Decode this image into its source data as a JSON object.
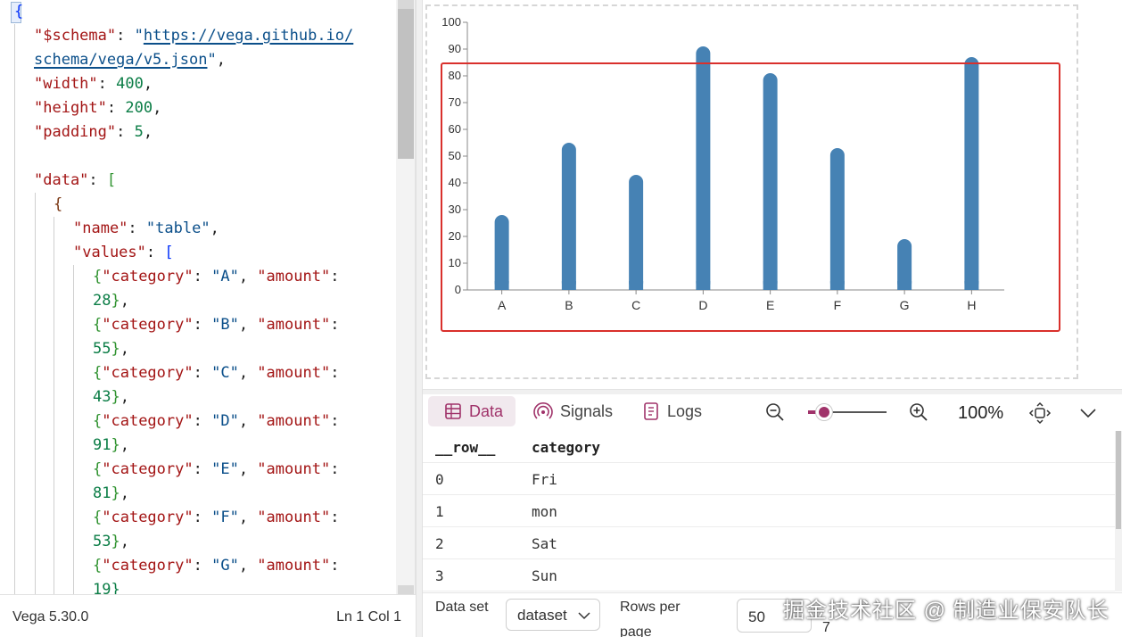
{
  "editor": {
    "code_lines": [
      [
        {
          "t": "{",
          "c": "b1"
        }
      ],
      [
        {
          "t": "\"$schema\"",
          "c": "k"
        },
        {
          "t": ": ",
          "c": "p"
        },
        {
          "t": "\"",
          "c": "s"
        },
        {
          "t": "https://vega.github.io/",
          "c": "s lnk"
        }
      ],
      [
        {
          "t": "schema/vega/v5.json",
          "c": "s lnk"
        },
        {
          "t": "\"",
          "c": "s"
        },
        {
          "t": ",",
          "c": "p"
        }
      ],
      [
        {
          "t": "\"width\"",
          "c": "k"
        },
        {
          "t": ": ",
          "c": "p"
        },
        {
          "t": "400",
          "c": "n"
        },
        {
          "t": ",",
          "c": "p"
        }
      ],
      [
        {
          "t": "\"height\"",
          "c": "k"
        },
        {
          "t": ": ",
          "c": "p"
        },
        {
          "t": "200",
          "c": "n"
        },
        {
          "t": ",",
          "c": "p"
        }
      ],
      [
        {
          "t": "\"padding\"",
          "c": "k"
        },
        {
          "t": ": ",
          "c": "p"
        },
        {
          "t": "5",
          "c": "n"
        },
        {
          "t": ",",
          "c": "p"
        }
      ],
      [],
      [
        {
          "t": "\"data\"",
          "c": "k"
        },
        {
          "t": ": ",
          "c": "p"
        },
        {
          "t": "[",
          "c": "b2"
        }
      ],
      [
        {
          "t": "{",
          "c": "b3"
        }
      ],
      [
        {
          "t": "\"name\"",
          "c": "k"
        },
        {
          "t": ": ",
          "c": "p"
        },
        {
          "t": "\"table\"",
          "c": "s"
        },
        {
          "t": ",",
          "c": "p"
        }
      ],
      [
        {
          "t": "\"values\"",
          "c": "k"
        },
        {
          "t": ": ",
          "c": "p"
        },
        {
          "t": "[",
          "c": "b1"
        }
      ],
      [
        {
          "t": "{",
          "c": "b2"
        },
        {
          "t": "\"category\"",
          "c": "k"
        },
        {
          "t": ": ",
          "c": "p"
        },
        {
          "t": "\"A\"",
          "c": "s"
        },
        {
          "t": ", ",
          "c": "p"
        },
        {
          "t": "\"amount\"",
          "c": "k"
        },
        {
          "t": ":",
          "c": "p"
        }
      ],
      [
        {
          "t": "28",
          "c": "n"
        },
        {
          "t": "}",
          "c": "b2"
        },
        {
          "t": ",",
          "c": "p"
        }
      ],
      [
        {
          "t": "{",
          "c": "b2"
        },
        {
          "t": "\"category\"",
          "c": "k"
        },
        {
          "t": ": ",
          "c": "p"
        },
        {
          "t": "\"B\"",
          "c": "s"
        },
        {
          "t": ", ",
          "c": "p"
        },
        {
          "t": "\"amount\"",
          "c": "k"
        },
        {
          "t": ":",
          "c": "p"
        }
      ],
      [
        {
          "t": "55",
          "c": "n"
        },
        {
          "t": "}",
          "c": "b2"
        },
        {
          "t": ",",
          "c": "p"
        }
      ],
      [
        {
          "t": "{",
          "c": "b2"
        },
        {
          "t": "\"category\"",
          "c": "k"
        },
        {
          "t": ": ",
          "c": "p"
        },
        {
          "t": "\"C\"",
          "c": "s"
        },
        {
          "t": ", ",
          "c": "p"
        },
        {
          "t": "\"amount\"",
          "c": "k"
        },
        {
          "t": ":",
          "c": "p"
        }
      ],
      [
        {
          "t": "43",
          "c": "n"
        },
        {
          "t": "}",
          "c": "b2"
        },
        {
          "t": ",",
          "c": "p"
        }
      ],
      [
        {
          "t": "{",
          "c": "b2"
        },
        {
          "t": "\"category\"",
          "c": "k"
        },
        {
          "t": ": ",
          "c": "p"
        },
        {
          "t": "\"D\"",
          "c": "s"
        },
        {
          "t": ", ",
          "c": "p"
        },
        {
          "t": "\"amount\"",
          "c": "k"
        },
        {
          "t": ":",
          "c": "p"
        }
      ],
      [
        {
          "t": "91",
          "c": "n"
        },
        {
          "t": "}",
          "c": "b2"
        },
        {
          "t": ",",
          "c": "p"
        }
      ],
      [
        {
          "t": "{",
          "c": "b2"
        },
        {
          "t": "\"category\"",
          "c": "k"
        },
        {
          "t": ": ",
          "c": "p"
        },
        {
          "t": "\"E\"",
          "c": "s"
        },
        {
          "t": ", ",
          "c": "p"
        },
        {
          "t": "\"amount\"",
          "c": "k"
        },
        {
          "t": ":",
          "c": "p"
        }
      ],
      [
        {
          "t": "81",
          "c": "n"
        },
        {
          "t": "}",
          "c": "b2"
        },
        {
          "t": ",",
          "c": "p"
        }
      ],
      [
        {
          "t": "{",
          "c": "b2"
        },
        {
          "t": "\"category\"",
          "c": "k"
        },
        {
          "t": ": ",
          "c": "p"
        },
        {
          "t": "\"F\"",
          "c": "s"
        },
        {
          "t": ", ",
          "c": "p"
        },
        {
          "t": "\"amount\"",
          "c": "k"
        },
        {
          "t": ":",
          "c": "p"
        }
      ],
      [
        {
          "t": "53",
          "c": "n"
        },
        {
          "t": "}",
          "c": "b2"
        },
        {
          "t": ",",
          "c": "p"
        }
      ],
      [
        {
          "t": "{",
          "c": "b2"
        },
        {
          "t": "\"category\"",
          "c": "k"
        },
        {
          "t": ": ",
          "c": "p"
        },
        {
          "t": "\"G\"",
          "c": "s"
        },
        {
          "t": ", ",
          "c": "p"
        },
        {
          "t": "\"amount\"",
          "c": "k"
        },
        {
          "t": ":",
          "c": "p"
        }
      ],
      [
        {
          "t": "19}",
          "c": "n"
        }
      ]
    ]
  },
  "status": {
    "version": "Vega 5.30.0",
    "position": "Ln 1 Col 1"
  },
  "chart_data": {
    "type": "bar",
    "categories": [
      "A",
      "B",
      "C",
      "D",
      "E",
      "F",
      "G",
      "H"
    ],
    "values": [
      28,
      55,
      43,
      91,
      81,
      53,
      19,
      87
    ],
    "yticks": [
      0,
      10,
      20,
      30,
      40,
      50,
      60,
      70,
      80,
      90,
      100
    ],
    "ylim": [
      0,
      100
    ],
    "bar_color": "#4682b4",
    "highlight_color": "#d9302c"
  },
  "viewer": {
    "tabs": [
      {
        "label": "Data",
        "icon": "table-icon"
      },
      {
        "label": "Signals",
        "icon": "signal-icon"
      },
      {
        "label": "Logs",
        "icon": "logs-icon"
      }
    ],
    "zoom_level": "100%",
    "zoom_fraction": 0.2,
    "columns": [
      "__row__",
      "category"
    ],
    "rows": [
      [
        "0",
        "Fri"
      ],
      [
        "1",
        "mon"
      ],
      [
        "2",
        "Sat"
      ],
      [
        "3",
        "Sun"
      ]
    ],
    "pager": {
      "dataset_label": "Data set",
      "dataset_value": "dataset",
      "rows_label": "Rows per page",
      "rows_value": "50",
      "extra": "7"
    },
    "accent": "#a0336a"
  },
  "watermark": "掘金技术社区 @ 制造业保安队长"
}
